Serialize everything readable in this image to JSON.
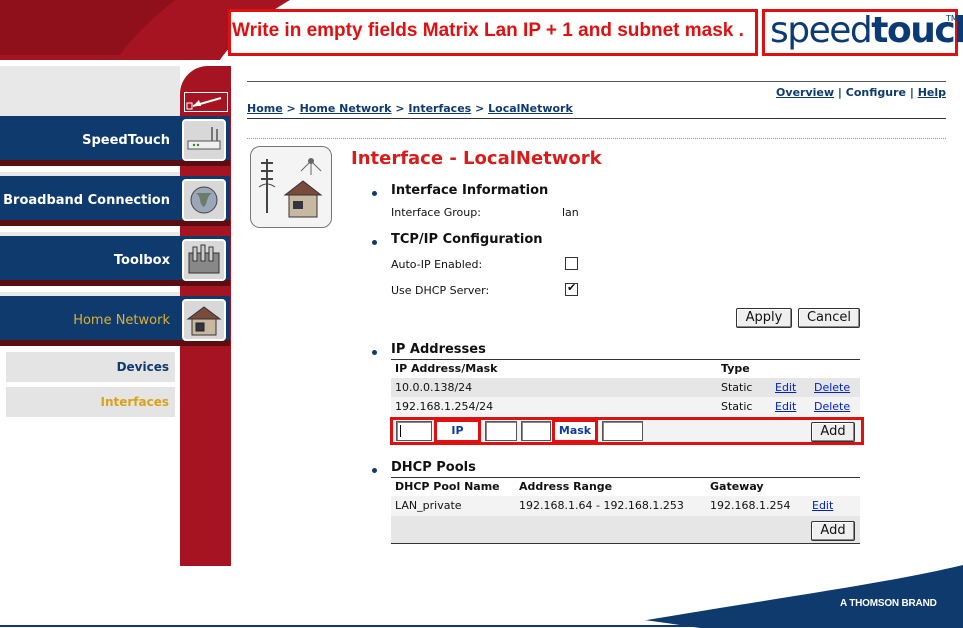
{
  "annotation": {
    "instruction": "Write in empty fields Matrix Lan IP + 1 and subnet mask ."
  },
  "brand": {
    "logo_light": "speed",
    "logo_bold": "touch",
    "trademark": "TM",
    "footer": "A THOMSON BRAND"
  },
  "colors": {
    "brand_blue": "#0e3a6e",
    "brand_red": "#a51420",
    "title_red": "#d81c1c",
    "annotation_red": "#e01010",
    "active_gold": "#d9a21c"
  },
  "sidebar": {
    "items": [
      {
        "label": "SpeedTouch",
        "icon": "router-icon"
      },
      {
        "label": "Broadband Connection",
        "icon": "globe-icon"
      },
      {
        "label": "Toolbox",
        "icon": "toolbox-icon"
      },
      {
        "label": "Home Network",
        "icon": "house-icon",
        "active": true
      }
    ],
    "subitems": [
      {
        "label": "Devices"
      },
      {
        "label": "Interfaces",
        "active": true
      }
    ]
  },
  "toplinks": {
    "overview": "Overview",
    "sep1": "|",
    "configure": "Configure",
    "sep2": "|",
    "help": "Help"
  },
  "breadcrumb": {
    "home": "Home",
    "sep": ">",
    "home_network": "Home Network",
    "interfaces": "Interfaces",
    "local_network": "LocalNetwork"
  },
  "page": {
    "title": "Interface - LocalNetwork",
    "interface_info": {
      "heading": "Interface Information",
      "group_label": "Interface Group:",
      "group_value": "lan"
    },
    "tcpip": {
      "heading": "TCP/IP Configuration",
      "auto_ip_label": "Auto-IP Enabled:",
      "auto_ip_checked": false,
      "dhcp_label": "Use DHCP Server:",
      "dhcp_checked": true,
      "apply": "Apply",
      "cancel": "Cancel"
    },
    "ip_addresses": {
      "heading": "IP Addresses",
      "columns": [
        "IP Address/Mask",
        "Type"
      ],
      "rows": [
        {
          "address": "10.0.0.138/24",
          "type": "Static",
          "edit": "Edit",
          "delete": "Delete"
        },
        {
          "address": "192.168.1.254/24",
          "type": "Static",
          "edit": "Edit",
          "delete": "Delete"
        }
      ],
      "new_entry": {
        "ip_callout": "IP",
        "mask_callout": "Mask",
        "add": "Add"
      }
    },
    "dhcp_pools": {
      "heading": "DHCP Pools",
      "columns": [
        "DHCP Pool Name",
        "Address Range",
        "Gateway"
      ],
      "rows": [
        {
          "name": "LAN_private",
          "range": "192.168.1.64 - 192.168.1.253",
          "gateway": "192.168.1.254",
          "edit": "Edit"
        }
      ],
      "add": "Add"
    }
  }
}
